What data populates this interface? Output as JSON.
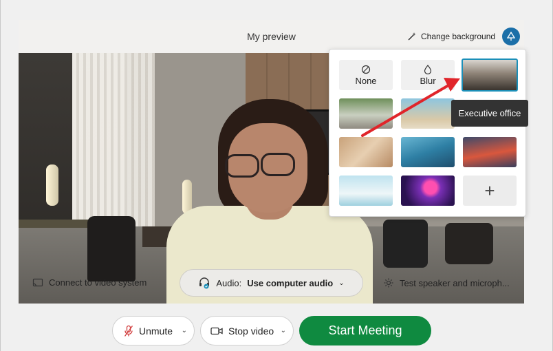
{
  "preview": {
    "title": "My preview",
    "change_background_label": "Change background"
  },
  "background_panel": {
    "none_label": "None",
    "blur_label": "Blur",
    "tooltip": "Executive office",
    "add_symbol": "+"
  },
  "preview_bar": {
    "connect_label": "Connect to video system",
    "audio_prefix": "Audio:",
    "audio_value": "Use computer audio",
    "test_label": "Test speaker and microph..."
  },
  "actions": {
    "unmute_label": "Unmute",
    "stop_video_label": "Stop video",
    "start_meeting_label": "Start Meeting"
  },
  "colors": {
    "start_button": "#0f8a40",
    "accent": "#1b8fb8",
    "annotation_arrow": "#e0252a"
  }
}
